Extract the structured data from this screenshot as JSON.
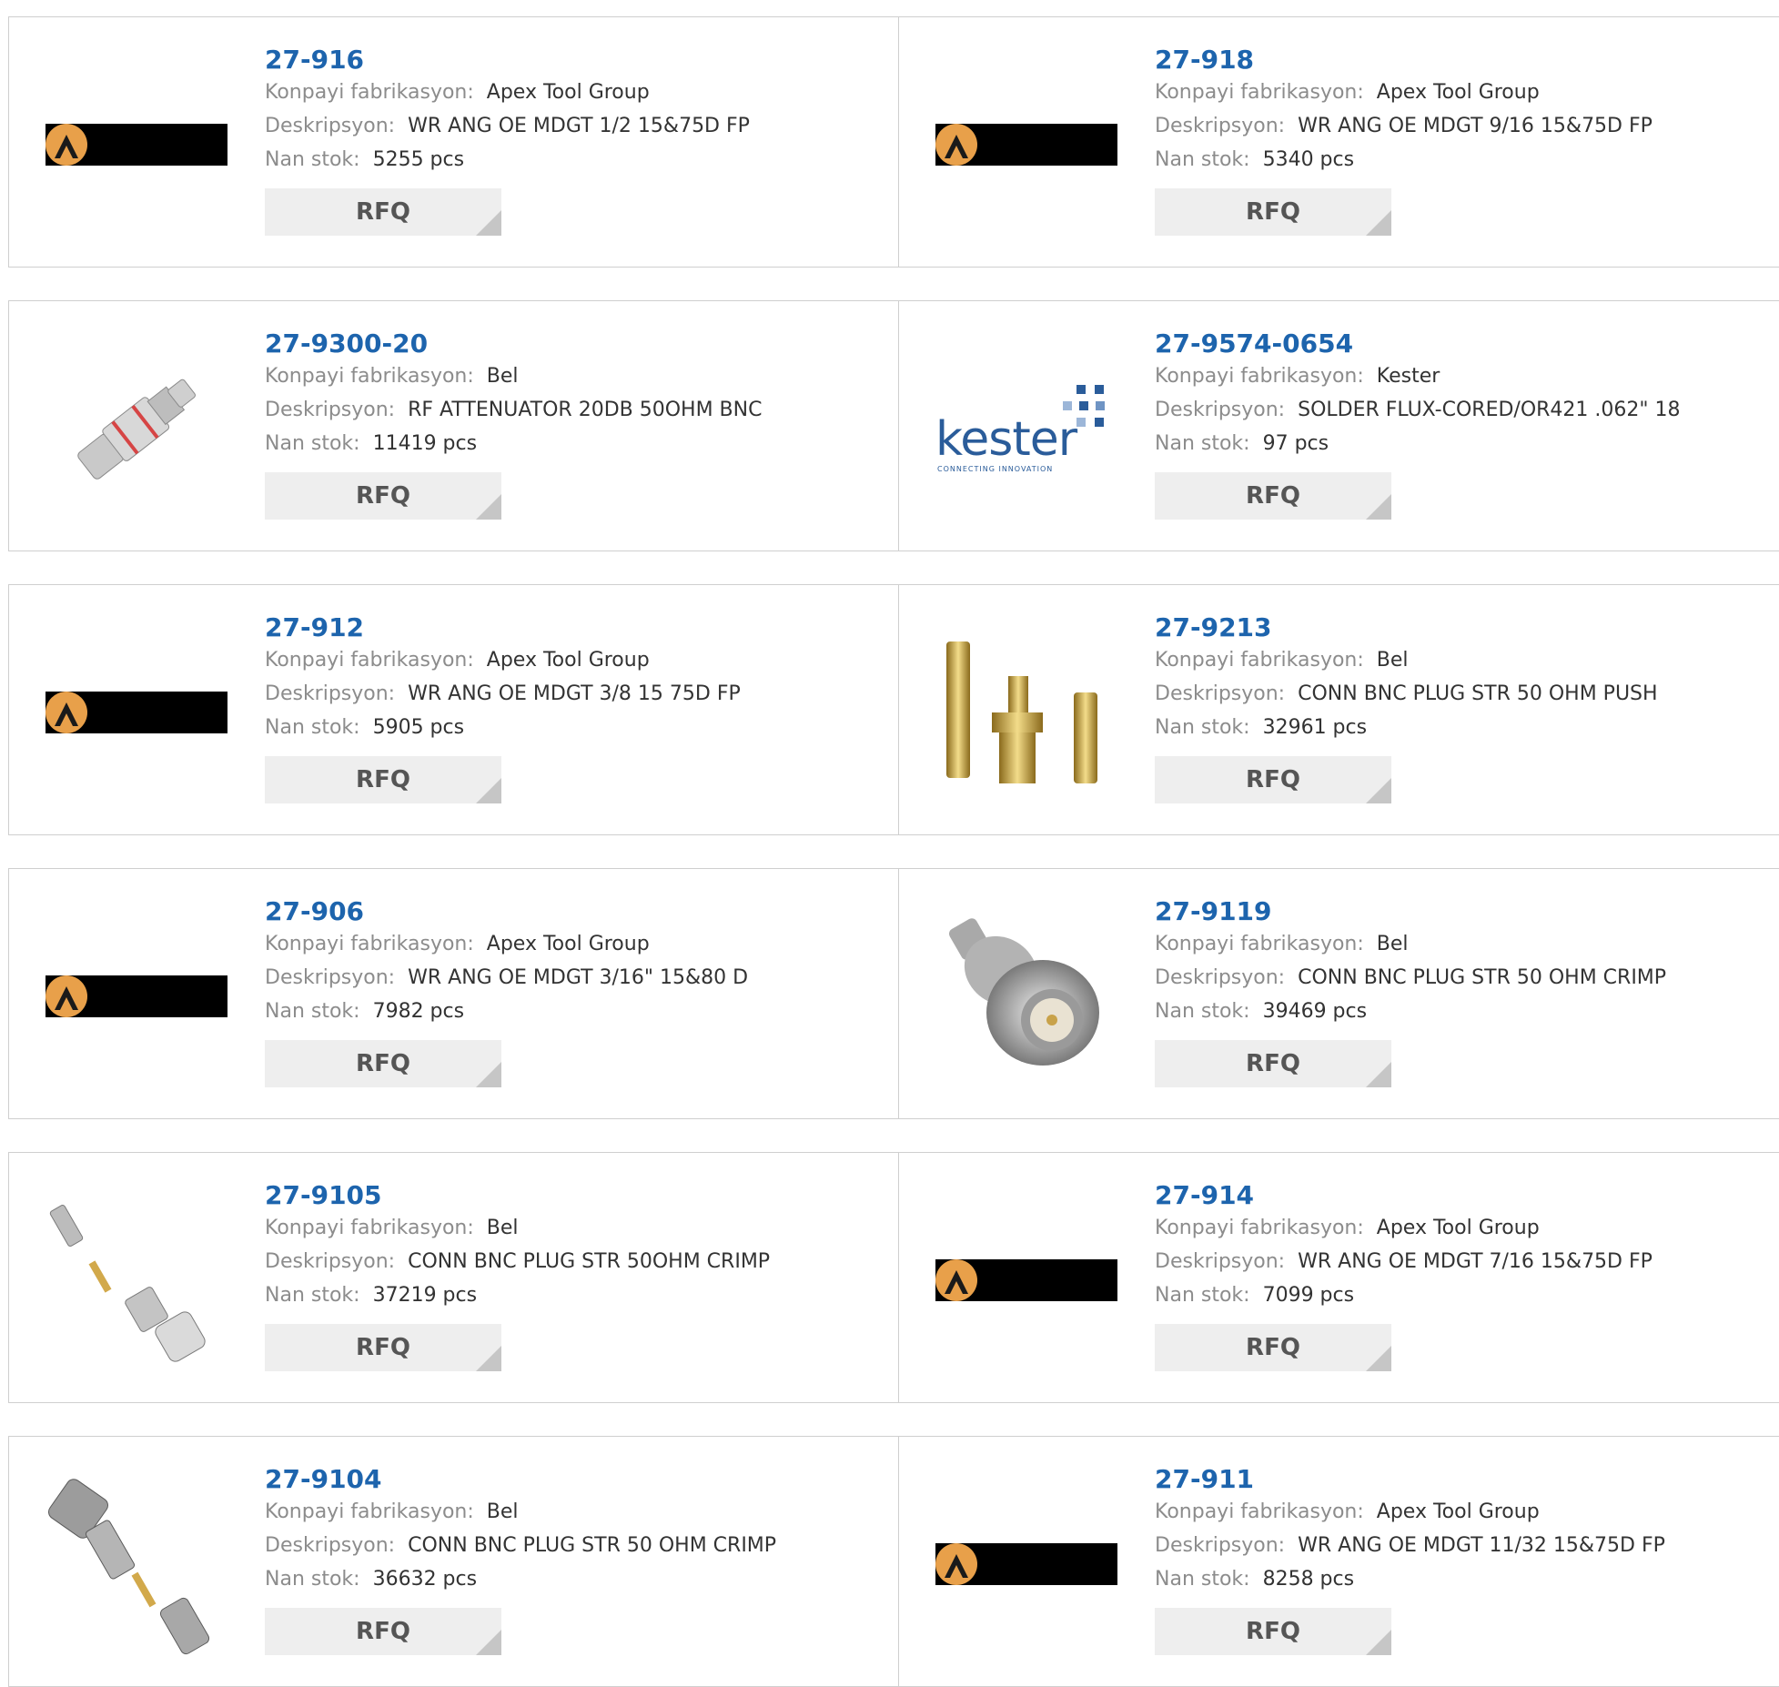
{
  "labels": {
    "manufacturer": "Konpayi fabrikasyon:",
    "description": "Deskripsyon:",
    "stock": "Nan stok:",
    "rfq": "RFQ"
  },
  "colors": {
    "part_number": "#1d64ad",
    "label": "#8c8c8c",
    "value": "#333333",
    "button_bg": "#eeeeee",
    "border": "#cfcfcf"
  },
  "products": [
    {
      "part_number": "27-916",
      "manufacturer": "Apex Tool Group",
      "description": "WR ANG OE MDGT 1/2 15&75D FP",
      "stock": "5255 pcs",
      "image": "apex-logo"
    },
    {
      "part_number": "27-918",
      "manufacturer": "Apex Tool Group",
      "description": "WR ANG OE MDGT 9/16 15&75D FP",
      "stock": "5340 pcs",
      "image": "apex-logo"
    },
    {
      "part_number": "27-9300-20",
      "manufacturer": "Bel",
      "description": "RF ATTENUATOR 20DB 50OHM BNC",
      "stock": "11419 pcs",
      "image": "bnc-attenuator"
    },
    {
      "part_number": "27-9574-0654",
      "manufacturer": "Kester",
      "description": "SOLDER FLUX-CORED/OR421 .062\" 18",
      "stock": "97 pcs",
      "image": "kester-logo",
      "logo_text": "kester",
      "logo_tagline": "CONNECTING INNOVATION"
    },
    {
      "part_number": "27-912",
      "manufacturer": "Apex Tool Group",
      "description": "WR ANG OE MDGT 3/8 15 75D FP",
      "stock": "5905 pcs",
      "image": "apex-logo"
    },
    {
      "part_number": "27-9213",
      "manufacturer": "Bel",
      "description": "CONN BNC PLUG STR 50 OHM PUSH",
      "stock": "32961 pcs",
      "image": "bnc-gold-parts"
    },
    {
      "part_number": "27-906",
      "manufacturer": "Apex Tool Group",
      "description": "WR ANG OE MDGT 3/16\" 15&80 D",
      "stock": "7982 pcs",
      "image": "apex-logo"
    },
    {
      "part_number": "27-9119",
      "manufacturer": "Bel",
      "description": "CONN BNC PLUG STR 50 OHM CRIMP",
      "stock": "39469 pcs",
      "image": "bnc-plug"
    },
    {
      "part_number": "27-9105",
      "manufacturer": "Bel",
      "description": "CONN BNC PLUG STR 50OHM CRIMP",
      "stock": "37219 pcs",
      "image": "bnc-crimp-kit"
    },
    {
      "part_number": "27-914",
      "manufacturer": "Apex Tool Group",
      "description": "WR ANG OE MDGT 7/16 15&75D FP",
      "stock": "7099 pcs",
      "image": "apex-logo"
    },
    {
      "part_number": "27-9104",
      "manufacturer": "Bel",
      "description": "CONN BNC PLUG STR 50 OHM CRIMP",
      "stock": "36632 pcs",
      "image": "bnc-crimp-kit-2"
    },
    {
      "part_number": "27-911",
      "manufacturer": "Apex Tool Group",
      "description": "WR ANG OE MDGT 11/32 15&75D FP",
      "stock": "8258 pcs",
      "image": "apex-logo"
    }
  ]
}
